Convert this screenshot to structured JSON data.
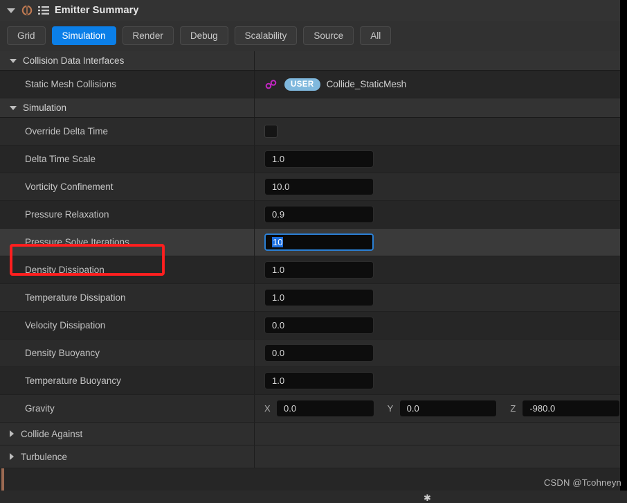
{
  "panel": {
    "title": "Emitter Summary",
    "collapse_icon": "triangle-down-icon",
    "emitter_icon": "emitter-icon",
    "list_icon": "list-icon"
  },
  "tabs": [
    {
      "label": "Grid",
      "active": false
    },
    {
      "label": "Simulation",
      "active": true
    },
    {
      "label": "Render",
      "active": false
    },
    {
      "label": "Debug",
      "active": false
    },
    {
      "label": "Scalability",
      "active": false
    },
    {
      "label": "Source",
      "active": false
    },
    {
      "label": "All",
      "active": false
    }
  ],
  "sections": [
    {
      "name": "Collision Data Interfaces",
      "expanded": true,
      "rows": [
        {
          "label": "Static Mesh Collisions",
          "type": "asset",
          "link_icon": "link-icon",
          "badge": "USER",
          "value": "Collide_StaticMesh"
        }
      ]
    },
    {
      "name": "Simulation",
      "expanded": true,
      "rows": [
        {
          "label": "Override Delta Time",
          "type": "checkbox",
          "checked": false
        },
        {
          "label": "Delta Time Scale",
          "type": "number",
          "value": "1.0"
        },
        {
          "label": "Vorticity Confinement",
          "type": "number",
          "value": "10.0"
        },
        {
          "label": "Pressure Relaxation",
          "type": "number",
          "value": "0.9"
        },
        {
          "label": "Pressure Solve Iterations",
          "type": "number",
          "value": "10",
          "focused": true,
          "selected": true,
          "annotated": true
        },
        {
          "label": "Density Dissipation",
          "type": "number",
          "value": "1.0"
        },
        {
          "label": "Temperature Dissipation",
          "type": "number",
          "value": "1.0"
        },
        {
          "label": "Velocity Dissipation",
          "type": "number",
          "value": "0.0"
        },
        {
          "label": "Density Buoyancy",
          "type": "number",
          "value": "0.0"
        },
        {
          "label": "Temperature Buoyancy",
          "type": "number",
          "value": "1.0"
        },
        {
          "label": "Gravity",
          "type": "vector",
          "axes": [
            {
              "axis": "X",
              "value": "0.0"
            },
            {
              "axis": "Y",
              "value": "0.0"
            },
            {
              "axis": "Z",
              "value": "-980.0"
            }
          ]
        }
      ]
    }
  ],
  "collapsed_sections": [
    {
      "label": "Collide Against",
      "expanded": false
    },
    {
      "label": "Turbulence",
      "expanded": false
    }
  ],
  "watermark": "CSDN @Tcohneyn",
  "bottom_cursor_glyph": "✱",
  "colors": {
    "accent_rail": "#9c6a52",
    "tab_active": "#0b7fe8",
    "focus_border": "#2a7fd4",
    "text_selection": "#1c6fe0",
    "user_badge": "#7fb8dd",
    "link_icon": "#c226c2",
    "annotation_box": "#ff1f1f",
    "panel_bg": "#262626"
  }
}
